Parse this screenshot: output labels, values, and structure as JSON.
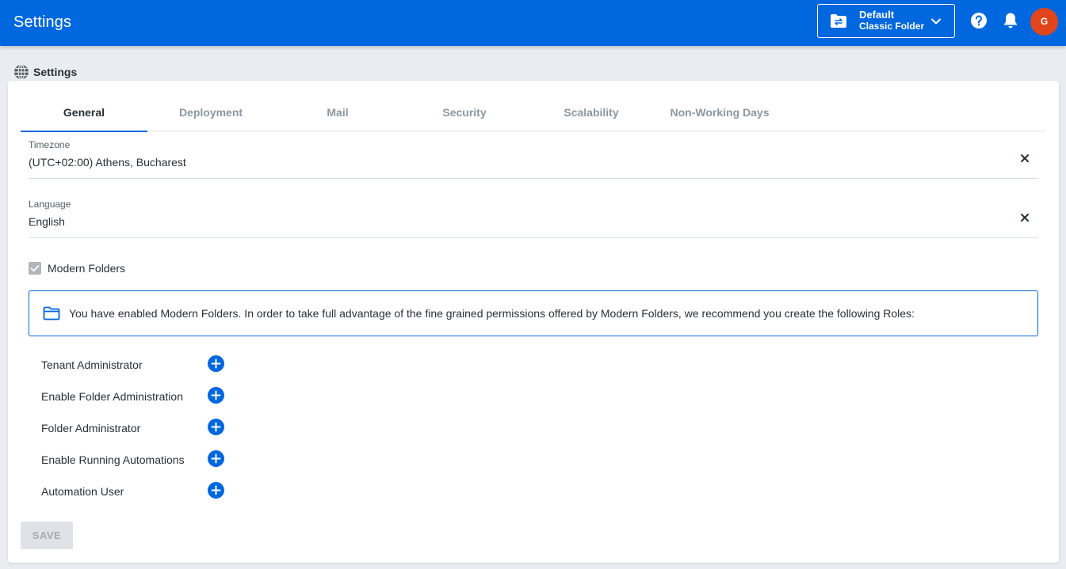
{
  "header": {
    "title": "Settings",
    "folder_selector": {
      "name": "Default",
      "type": "Classic Folder",
      "icon": "folder-switch-icon"
    },
    "help_icon": "help-circle-icon",
    "notifications_icon": "bell-icon",
    "avatar_initial": "G",
    "brand_color": "#0067df",
    "avatar_color": "#e0451c"
  },
  "page": {
    "title": "Settings",
    "icon": "globe-icon"
  },
  "tabs": [
    {
      "label": "General",
      "active": true
    },
    {
      "label": "Deployment",
      "active": false
    },
    {
      "label": "Mail",
      "active": false
    },
    {
      "label": "Security",
      "active": false
    },
    {
      "label": "Scalability",
      "active": false
    },
    {
      "label": "Non-Working Days",
      "active": false
    }
  ],
  "fields": {
    "timezone": {
      "label": "Timezone",
      "value": "(UTC+02:00) Athens, Bucharest"
    },
    "language": {
      "label": "Language",
      "value": "English"
    }
  },
  "modern_folders": {
    "label": "Modern Folders",
    "checked": true,
    "disabled": true
  },
  "info_message": "You have enabled Modern Folders. In order to take full advantage of the fine grained permissions offered by Modern Folders, we recommend you create the following Roles:",
  "roles": [
    "Tenant Administrator",
    "Enable Folder Administration",
    "Folder Administrator",
    "Enable Running Automations",
    "Automation User"
  ],
  "save_label": "SAVE"
}
